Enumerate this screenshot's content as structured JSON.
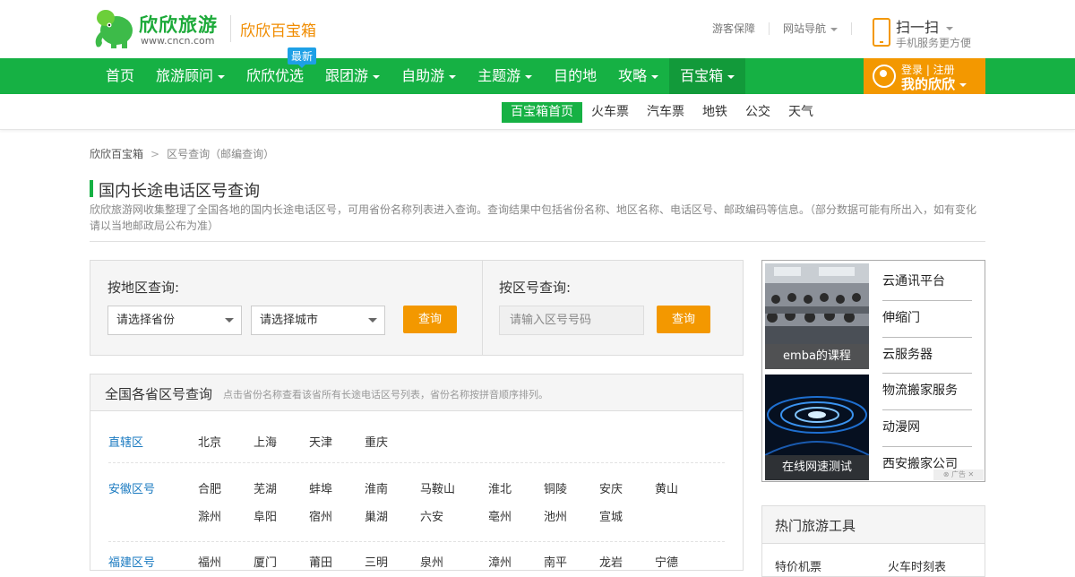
{
  "brand": {
    "name": "欣欣旅游",
    "url": "www.cncn.com",
    "sub": "欣欣百宝箱"
  },
  "top_links": {
    "guarantee": "游客保障",
    "site_nav": "网站导航"
  },
  "scan": {
    "title": "扫一扫",
    "sub": "手机服务更方便"
  },
  "nav": {
    "items": [
      "首页",
      "旅游顾问",
      "欣欣优选",
      "跟团游",
      "自助游",
      "主题游",
      "目的地",
      "攻略",
      "百宝箱"
    ],
    "dropdown_flags": [
      false,
      true,
      false,
      true,
      true,
      true,
      false,
      true,
      true
    ],
    "active_index": 8,
    "badge": "最新"
  },
  "login": {
    "line1": "登录 | 注册",
    "line2": "我的欣欣"
  },
  "subnav": [
    "百宝箱首页",
    "火车票",
    "汽车票",
    "地铁",
    "公交",
    "天气"
  ],
  "breadcrumb": {
    "home": "欣欣百宝箱",
    "sep": ">",
    "current": "区号查询（邮编查询）"
  },
  "page": {
    "title": "国内长途电话区号查询",
    "desc": "欣欣旅游网收集整理了全国各地的国内长途电话区号，可用省份名称列表进入查询。查询结果中包括省份名称、地区名称、电话区号、邮政编码等信息。（部分数据可能有所出入，如有变化请以当地邮政局公布为准）"
  },
  "search": {
    "by_region_label": "按地区查询:",
    "province_placeholder": "请选择省份",
    "city_placeholder": "请选择城市",
    "query_button": "查询",
    "by_code_label": "按区号查询:",
    "code_placeholder": "请输入区号号码"
  },
  "provinces_box": {
    "title": "全国各省区号查询",
    "note": "点击省份名称查看该省所有长途电话区号列表，省份名称按拼音顺序排列。",
    "rows": [
      {
        "name": "直辖区",
        "cities": [
          "北京",
          "上海",
          "天津",
          "重庆"
        ]
      },
      {
        "name": "安徽区号",
        "cities": [
          "合肥",
          "芜湖",
          "蚌埠",
          "淮南",
          "马鞍山",
          "淮北",
          "铜陵",
          "安庆",
          "黄山",
          "滁州",
          "阜阳",
          "宿州",
          "巢湖",
          "六安",
          "亳州",
          "池州",
          "宣城"
        ]
      },
      {
        "name": "福建区号",
        "cities": [
          "福州",
          "厦门",
          "莆田",
          "三明",
          "泉州",
          "漳州",
          "南平",
          "龙岩",
          "宁德"
        ]
      }
    ]
  },
  "ad": {
    "captions": [
      "emba的课程",
      "在线网速测试"
    ],
    "links": [
      "云通讯平台",
      "伸缩门",
      "云服务器",
      "物流搬家服务",
      "动漫网",
      "西安搬家公司"
    ]
  },
  "tools": {
    "title": "热门旅游工具",
    "item_left": "特价机票",
    "item_right": "火车时刻表"
  }
}
